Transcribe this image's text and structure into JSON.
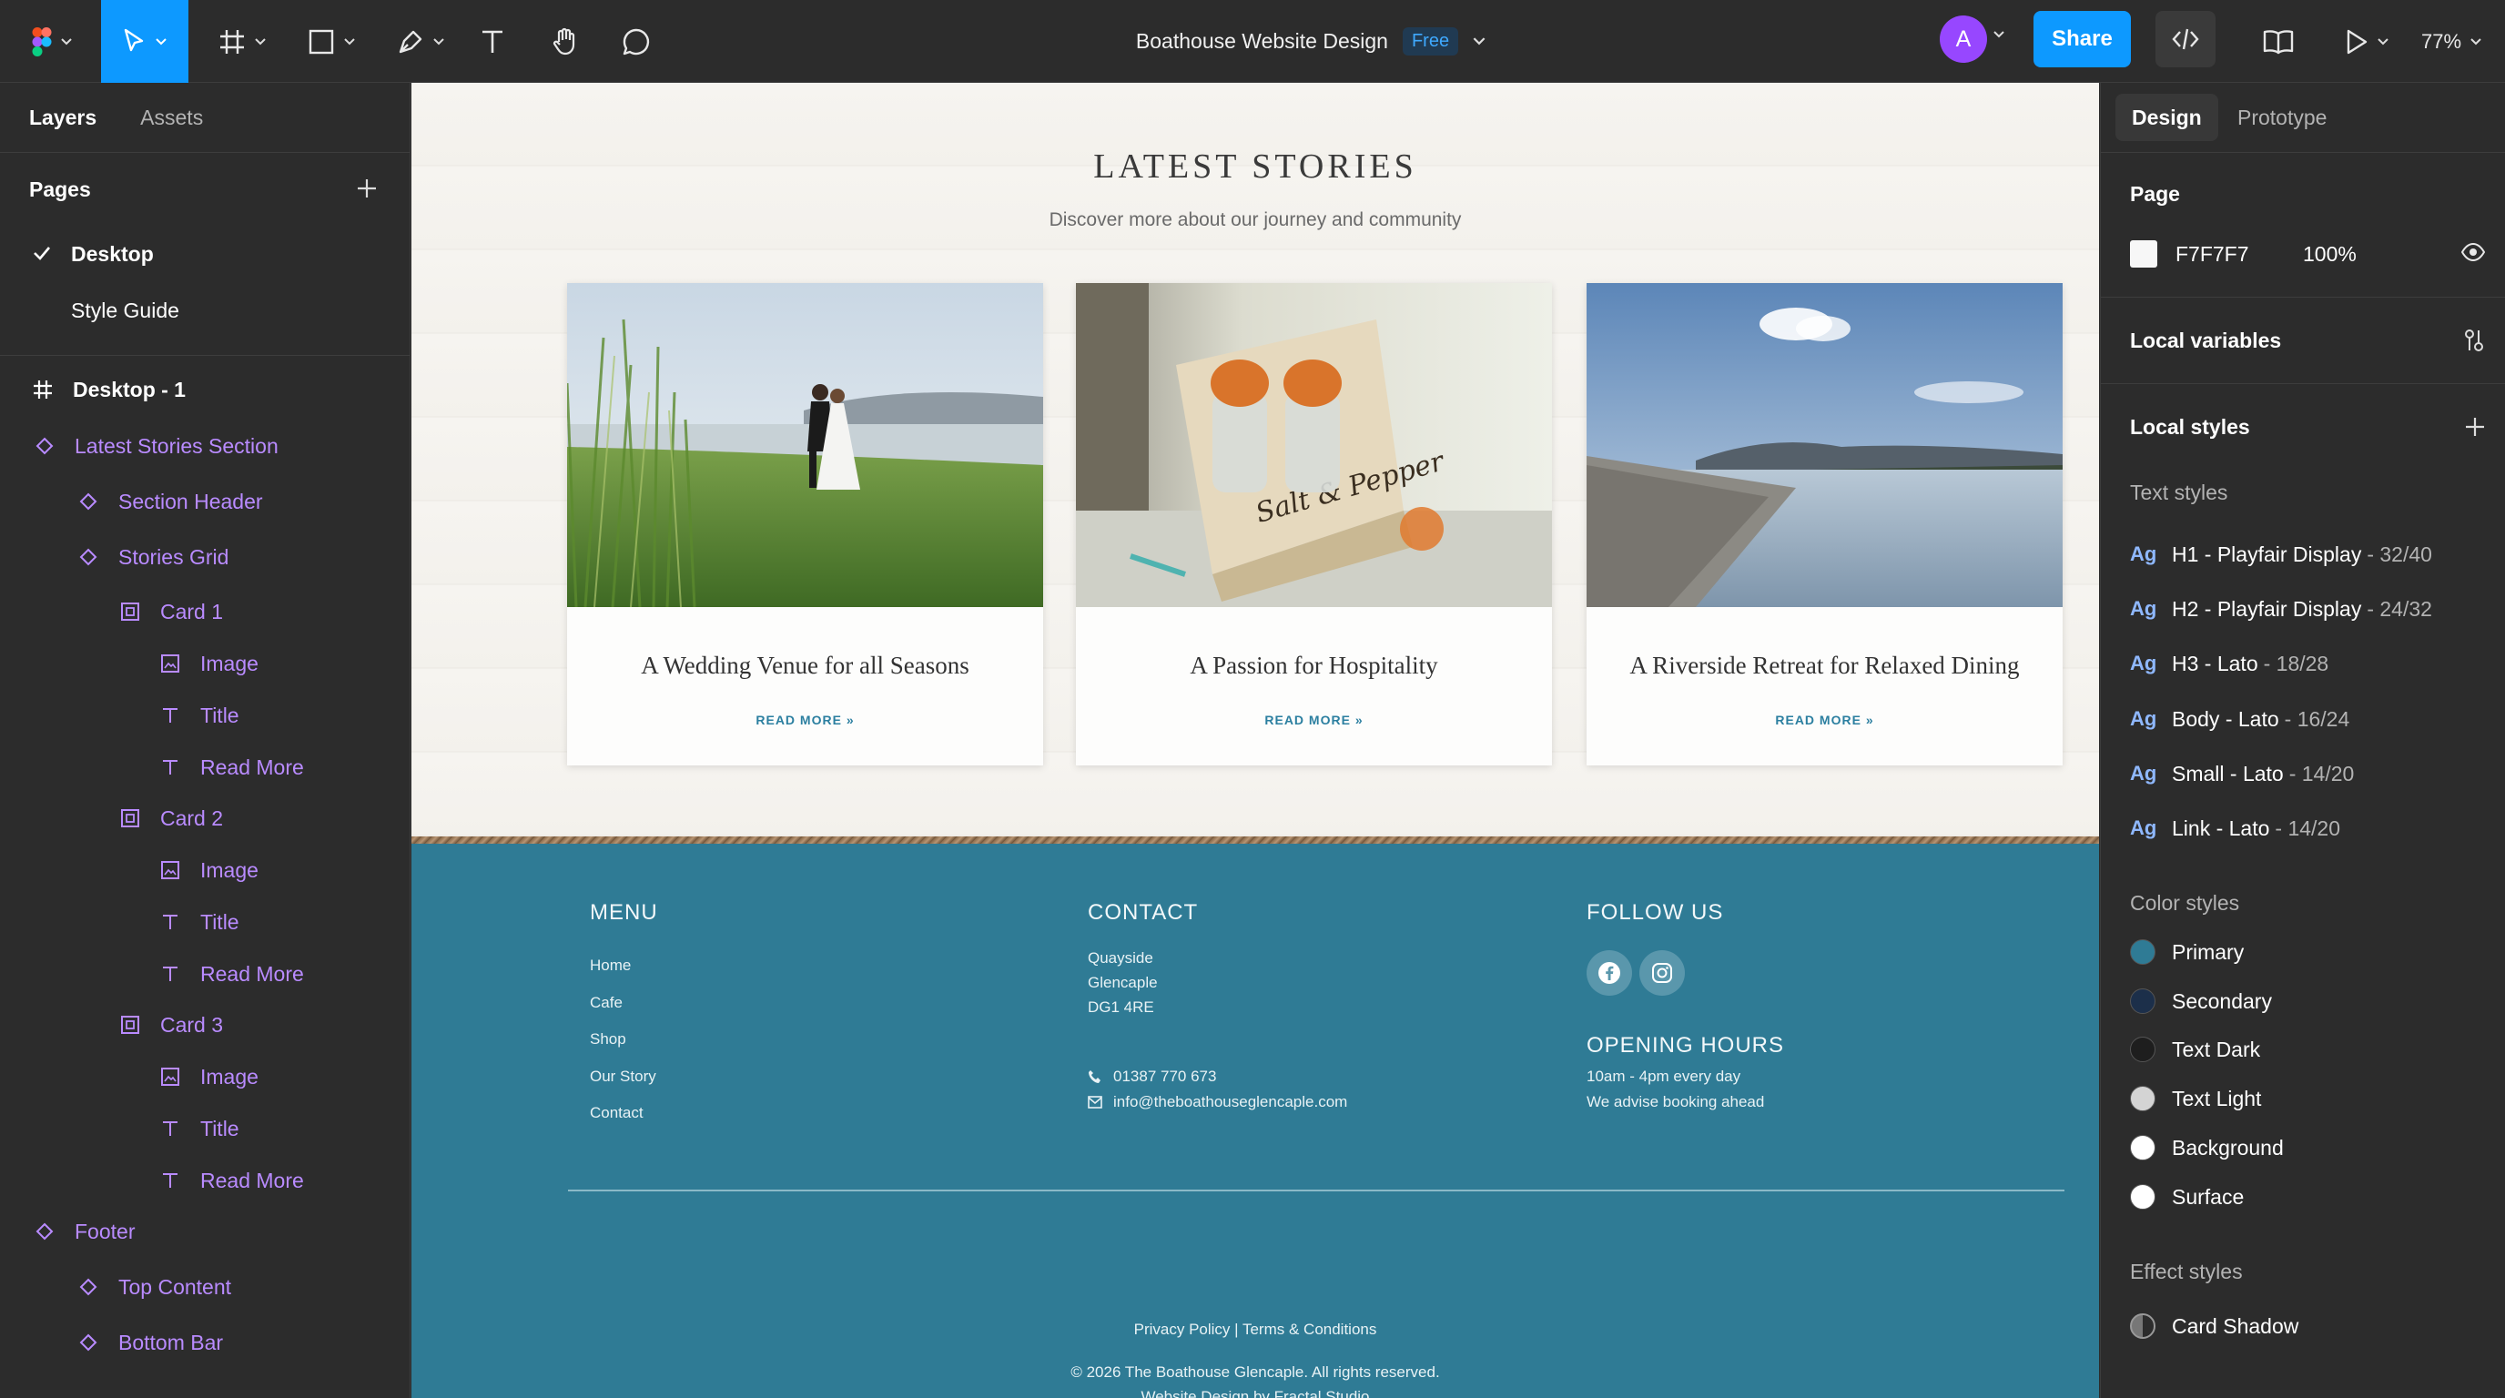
{
  "file": {
    "title": "Boathouse Website Design",
    "plan_badge": "Free",
    "zoom": "77%",
    "avatar_initial": "A",
    "share_label": "Share"
  },
  "left_panel": {
    "tabs": [
      "Layers",
      "Assets"
    ],
    "pages_label": "Pages",
    "pages": [
      "Desktop",
      "Style Guide"
    ],
    "layers": [
      "Desktop - 1",
      "Latest Stories Section",
      "Section Header",
      "Stories Grid",
      "Card 1",
      "Image",
      "Title",
      "Read More",
      "Card 2",
      "Image",
      "Title",
      "Read More",
      "Card 3",
      "Image",
      "Title",
      "Read More",
      "Footer",
      "Top Content",
      "Bottom Bar"
    ]
  },
  "canvas": {
    "section_title": "LATEST STORIES",
    "section_subtitle": "Discover more about our journey and community",
    "cards": [
      {
        "title": "A Wedding Venue for all Seasons",
        "link": "READ MORE »"
      },
      {
        "title": "A Passion for Hospitality",
        "link": "READ MORE »"
      },
      {
        "title": "A Riverside Retreat for Relaxed Dining",
        "link": "READ MORE »"
      }
    ],
    "footer": {
      "menu_heading": "MENU",
      "menu_items": [
        "Home",
        "Cafe",
        "Shop",
        "Our Story",
        "Contact"
      ],
      "contact_heading": "CONTACT",
      "address": [
        "Quayside",
        "Glencaple",
        "DG1 4RE"
      ],
      "phone": "01387 770 673",
      "email": "info@theboathouseglencaple.com",
      "follow_heading": "FOLLOW US",
      "hours_heading": "OPENING HOURS",
      "hours_lines": [
        "10am - 4pm every day",
        "We advise booking ahead"
      ],
      "legal_links": "Privacy Policy | Terms & Conditions",
      "copyright": "© 2026 The Boathouse Glencaple. All rights reserved.",
      "credit": "Website Design by Fractal Studio"
    }
  },
  "right_panel": {
    "tabs": [
      "Design",
      "Prototype"
    ],
    "page_label": "Page",
    "page_color": "F7F7F7",
    "page_opacity": "100%",
    "local_variables": "Local variables",
    "local_styles": "Local styles",
    "text_styles_label": "Text styles",
    "text_styles": [
      {
        "name": "H1 - Playfair Display",
        "spec": "- 32/40"
      },
      {
        "name": "H2 - Playfair Display",
        "spec": "- 24/32"
      },
      {
        "name": "H3 - Lato",
        "spec": "- 18/28"
      },
      {
        "name": "Body - Lato",
        "spec": "- 16/24"
      },
      {
        "name": "Small - Lato",
        "spec": "- 14/20"
      },
      {
        "name": "Link - Lato",
        "spec": "- 14/20"
      }
    ],
    "color_styles_label": "Color styles",
    "color_styles": [
      {
        "name": "Primary",
        "hex": "#2f7b95"
      },
      {
        "name": "Secondary",
        "hex": "#1c2f4a"
      },
      {
        "name": "Text Dark",
        "hex": "#1e1e1e"
      },
      {
        "name": "Text Light",
        "hex": "#d4d4d4"
      },
      {
        "name": "Background",
        "hex": "#ffffff"
      },
      {
        "name": "Surface",
        "hex": "#ffffff"
      }
    ],
    "effect_styles_label": "Effect styles",
    "effect_styles": [
      "Card Shadow"
    ]
  },
  "colors": {
    "accent": "#0d99ff",
    "layer_component": "#b98bff",
    "footer_bg": "#2f7b95"
  }
}
